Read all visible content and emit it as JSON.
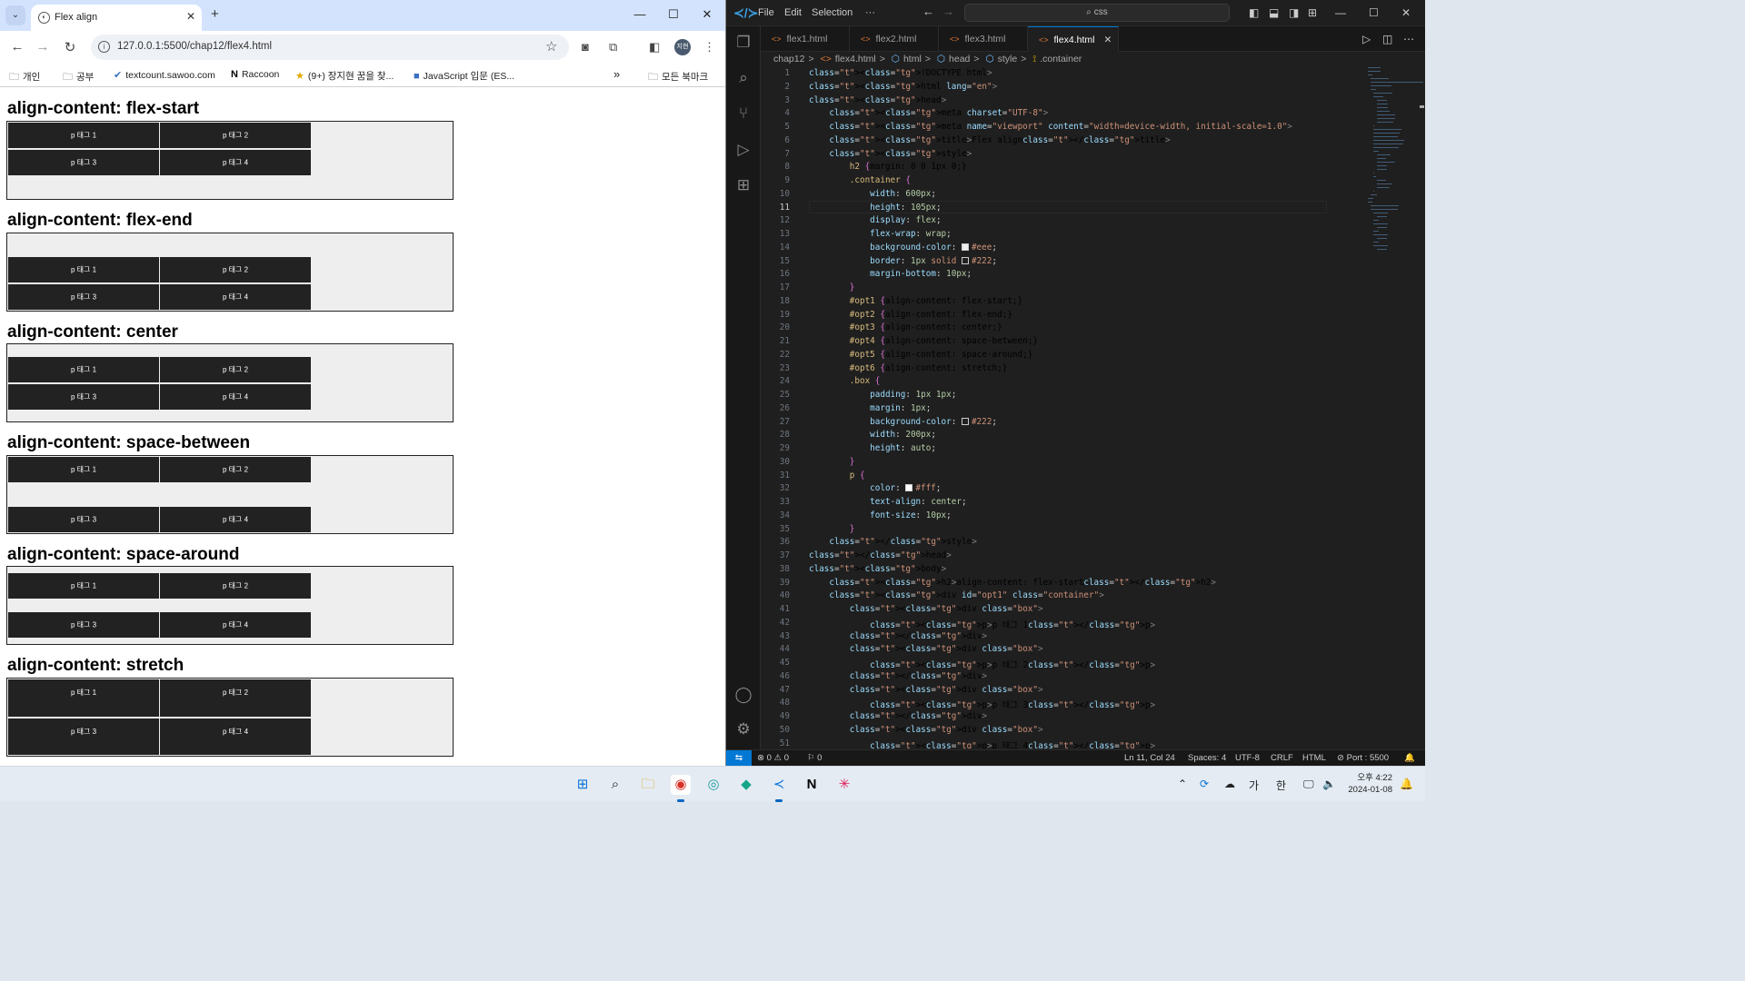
{
  "chrome": {
    "tab_title": "Flex align",
    "tab_close": "✕",
    "new_tab": "+",
    "url": "127.0.0.1:5500/chap12/flex4.html",
    "bookmarks": [
      {
        "label": "개인",
        "icon": "folder-icon"
      },
      {
        "label": "공부",
        "icon": "folder-icon"
      },
      {
        "label": "textcount.sawoo.com",
        "icon": "check-icon"
      },
      {
        "label": "Raccoon",
        "icon": "notion-icon"
      },
      {
        "label": "(9+) 장지현 꿈을 찾...",
        "icon": "star-icon"
      },
      {
        "label": "JavaScript 입문 (ES...",
        "icon": "bookmark-icon"
      }
    ],
    "bookmarks_more": "»",
    "all_bookmarks": "모든 북마크",
    "avatar_text": "지현"
  },
  "demo": {
    "sections": [
      {
        "heading": "align-content: flex-start",
        "boxes": [
          "p 태그 1",
          "p 태그 2",
          "p 태그 3",
          "p 태그 4"
        ]
      },
      {
        "heading": "align-content: flex-end",
        "boxes": [
          "p 태그 1",
          "p 태그 2",
          "p 태그 3",
          "p 태그 4"
        ]
      },
      {
        "heading": "align-content: center",
        "boxes": [
          "p 태그 1",
          "p 태그 2",
          "p 태그 3",
          "p 태그 4"
        ]
      },
      {
        "heading": "align-content: space-between",
        "boxes": [
          "p 태그 1",
          "p 태그 2",
          "p 태그 3",
          "p 태그 4"
        ]
      },
      {
        "heading": "align-content: space-around",
        "boxes": [
          "p 태그 1",
          "p 태그 2",
          "p 태그 3",
          "p 태그 4"
        ]
      },
      {
        "heading": "align-content: stretch",
        "boxes": [
          "p 태그 1",
          "p 태그 2",
          "p 태그 3",
          "p 태그 4"
        ]
      }
    ]
  },
  "vscode": {
    "menu": [
      "File",
      "Edit",
      "Selection",
      "···"
    ],
    "search": "css",
    "tabs": [
      "flex1.html",
      "flex2.html",
      "flex3.html",
      "flex4.html"
    ],
    "active_tab": "flex4.html",
    "breadcrumbs": [
      "chap12",
      "flex4.html",
      "html",
      "head",
      "style",
      ".container"
    ],
    "current_line": 11,
    "code": [
      "<!DOCTYPE html>",
      "<html lang=\"en\">",
      "<head>",
      "    <meta charset=\"UTF-8\">",
      "    <meta name=\"viewport\" content=\"width=device-width, initial-scale=1.0\">",
      "    <title>Flex align</title>",
      "    <style>",
      "        h2 {margin: 0 0 1px 0;}",
      "        .container {",
      "            width: 600px;",
      "            height: 105px;",
      "            display: flex;",
      "            flex-wrap: wrap;",
      "            background-color: #eee;",
      "            border: 1px solid #222;",
      "            margin-bottom: 10px;",
      "        }",
      "        #opt1 {align-content: flex-start;}",
      "        #opt2 {align-content: flex-end;}",
      "        #opt3 {align-content: center;}",
      "        #opt4 {align-content: space-between;}",
      "        #opt5 {align-content: space-around;}",
      "        #opt6 {align-content: stretch;}",
      "        .box {",
      "            padding: 1px 1px;",
      "            margin: 1px;",
      "            background-color: #222;",
      "            width: 200px;",
      "            height: auto;",
      "        }",
      "        p {",
      "            color: #fff;",
      "            text-align: center;",
      "            font-size: 10px;",
      "        }",
      "    </style>",
      "</head>",
      "<body>",
      "    <h2>align-content: flex-start</h2>",
      "    <div id=\"opt1\" class=\"container\">",
      "        <div class=\"box\">",
      "            <p>p 태그 1</p>",
      "        </div>",
      "        <div class=\"box\">",
      "            <p>p 태그 2</p>",
      "        </div>",
      "        <div class=\"box\">",
      "            <p>p 태그 3</p>",
      "        </div>",
      "        <div class=\"box\">",
      "            <p>p 태그 4</p>"
    ],
    "status": {
      "errors": "0",
      "warnings": "0",
      "ports": "0",
      "position": "Ln 11, Col 24",
      "spaces": "Spaces: 4",
      "encoding": "UTF-8",
      "eol": "CRLF",
      "language": "HTML",
      "port": "Port : 5500"
    }
  },
  "taskbar": {
    "apps": [
      "windows-start-icon",
      "search-icon",
      "file-explorer-icon",
      "chrome-icon",
      "edge-icon",
      "copilot-icon",
      "vscode-icon",
      "notion-icon",
      "slack-icon"
    ],
    "tray": {
      "ime1": "가",
      "ime2": "한"
    },
    "clock_time": "오후 4:22",
    "clock_date": "2024-01-08"
  },
  "colors": {
    "accent": "#0078d4",
    "container_bg": "#eee",
    "box_bg": "#222",
    "chrome_tabstrip": "#d3e3fd"
  }
}
